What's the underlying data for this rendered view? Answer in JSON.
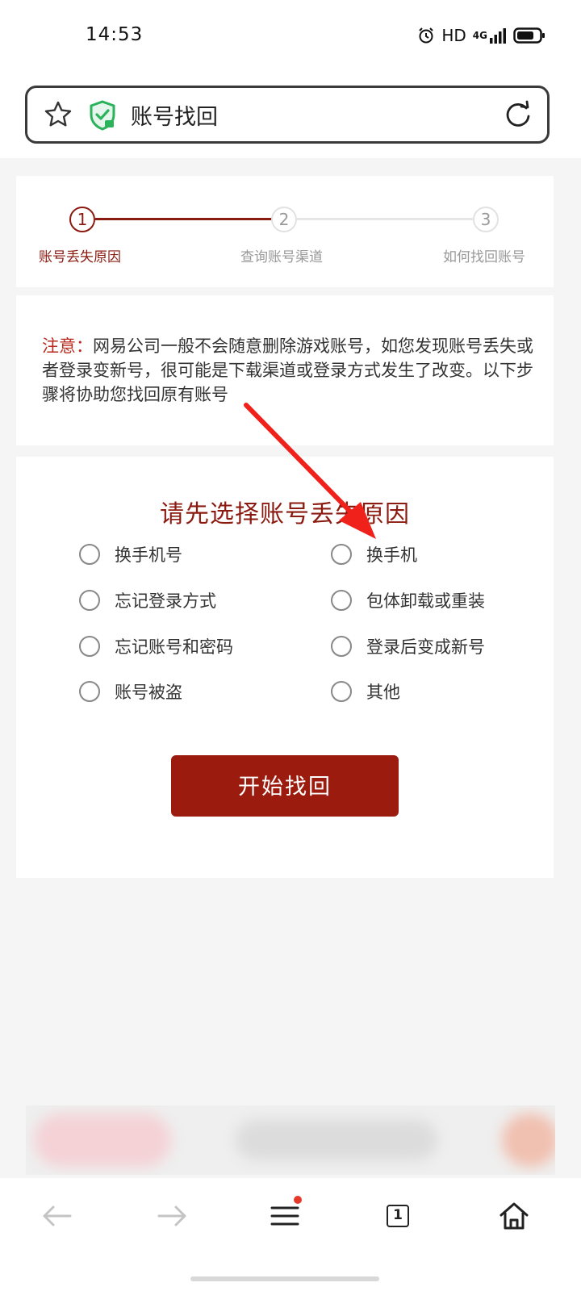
{
  "status_bar": {
    "time": "14:53",
    "network": "HD",
    "signal": "4G"
  },
  "url_bar": {
    "title": "账号找回"
  },
  "steps": [
    {
      "number": "1",
      "label": "账号丢失原因",
      "active": true
    },
    {
      "number": "2",
      "label": "查询账号渠道",
      "active": false
    },
    {
      "number": "3",
      "label": "如何找回账号",
      "active": false
    }
  ],
  "notice": {
    "label": "注意：",
    "text": "网易公司一般不会随意删除游戏账号，如您发现账号丢失或者登录变新号，很可能是下载渠道或登录方式发生了改变。以下步骤将协助您找回原有账号"
  },
  "selection": {
    "title": "请先选择账号丢失原因",
    "options": [
      "换手机号",
      "换手机",
      "忘记登录方式",
      "包体卸载或重装",
      "忘记账号和密码",
      "登录后变成新号",
      "账号被盗",
      "其他"
    ],
    "button_label": "开始找回"
  },
  "bottom_nav": {
    "tab_count": "1"
  },
  "colors": {
    "accent": "#8b1a10",
    "button": "#9b1c0f",
    "notice_label": "#b8281c",
    "arrow": "#f0201a"
  }
}
